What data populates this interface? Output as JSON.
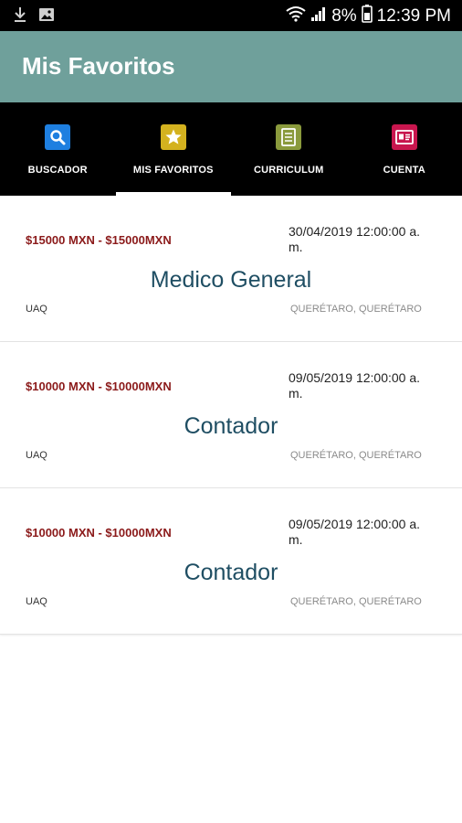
{
  "status_bar": {
    "battery": "8%",
    "time": "12:39 PM",
    "icons": [
      "download-icon",
      "image-icon",
      "wifi-icon",
      "signal-icon",
      "battery-icon"
    ]
  },
  "app_bar": {
    "title": "Mis Favoritos"
  },
  "tabs": [
    {
      "label": "BUSCADOR",
      "icon": "search-icon",
      "color": "#1e7fe0"
    },
    {
      "label": "MIS FAVORITOS",
      "icon": "star-icon",
      "color": "#d4b21f",
      "selected": true
    },
    {
      "label": "CURRICULUM",
      "icon": "document-icon",
      "color": "#8a9a3c"
    },
    {
      "label": "CUENTA",
      "icon": "id-card-icon",
      "color": "#c8164e"
    }
  ],
  "favorites": [
    {
      "salary": "$15000 MXN - $15000MXN",
      "date_line1": "30/04/2019 12:00:00 a.",
      "date_line2": "m.",
      "title": "Medico General",
      "company": "UAQ",
      "location": "QUERÉTARO, QUERÉTARO"
    },
    {
      "salary": "$10000 MXN - $10000MXN",
      "date_line1": "09/05/2019 12:00:00 a.",
      "date_line2": "m.",
      "title": "Contador",
      "company": "UAQ",
      "location": "QUERÉTARO, QUERÉTARO"
    },
    {
      "salary": "$10000 MXN - $10000MXN",
      "date_line1": "09/05/2019 12:00:00 a.",
      "date_line2": "m.",
      "title": "Contador",
      "company": "UAQ",
      "location": "QUERÉTARO, QUERÉTARO"
    }
  ],
  "colors": {
    "app_bar": "#6fa09b",
    "salary": "#8b1a1a",
    "job_title": "#1f4e63"
  }
}
